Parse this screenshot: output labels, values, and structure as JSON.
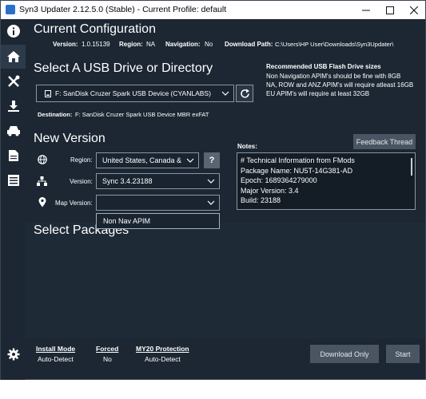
{
  "titlebar": {
    "title": "Syn3 Updater 2.12.5.0 (Stable) - Current Profile: default",
    "min_icon": "minimize-icon",
    "max_icon": "maximize-icon",
    "close_icon": "close-icon"
  },
  "sidebar": {
    "items": [
      {
        "name": "info-icon"
      },
      {
        "name": "home-icon",
        "active": true
      },
      {
        "name": "tools-icon"
      },
      {
        "name": "download-icon"
      },
      {
        "name": "car-icon"
      },
      {
        "name": "document-icon"
      },
      {
        "name": "list-icon"
      }
    ],
    "bottom": {
      "name": "gear-icon"
    }
  },
  "current_configuration": {
    "heading": "Current Configuration",
    "version_label": "Version:",
    "version_value": "1.0.15139",
    "region_label": "Region:",
    "region_value": "NA",
    "navigation_label": "Navigation:",
    "navigation_value": "No",
    "download_path_label": "Download Path:",
    "download_path_value": "C:\\Users\\HP User\\Downloads\\Syn3Updater\\"
  },
  "usb": {
    "heading": "Select A USB Drive or Directory",
    "drive_value": "F: SanDisk Cruzer Spark USB Device (CYANLABS)",
    "destination_label": "Destination:",
    "destination_value": "F: SanDisk Cruzer Spark USB Device  MBR exFAT",
    "recommended_title": "Recommended USB Flash Drive sizes",
    "recommended_text_1": "Non Navigation APIM's should be fine with 8GB",
    "recommended_text_2": "NA, ROW and ANZ APIM's will require atleast 16GB",
    "recommended_text_3": "EU APIM's will require at least 32GB"
  },
  "new_version": {
    "heading": "New Version",
    "region_label": "Region:",
    "region_value": "United States, Canada &",
    "help_label": "?",
    "version_label": "Version:",
    "version_value": "Sync 3.4.23188",
    "map_label": "Map Version:",
    "map_value": "",
    "map_options": [
      "Non Nav APIM"
    ],
    "notes_label": "Notes:",
    "feedback_label": "Feedback Thread",
    "notes_lines": [
      "# Technical Information from FMods",
      "Package Name: NU5T-14G381-AD",
      "Epoch:  1689364279000",
      "Major Version: 3.4",
      "Build: 23188"
    ]
  },
  "packages": {
    "heading": "Select Packages"
  },
  "footer": {
    "install_mode_title": "Install Mode",
    "install_mode_value": "Auto-Detect",
    "forced_title": "Forced",
    "forced_value": "No",
    "my20_title": "MY20 Protection",
    "my20_value": "Auto-Detect",
    "download_only_label": "Download Only",
    "start_label": "Start"
  }
}
